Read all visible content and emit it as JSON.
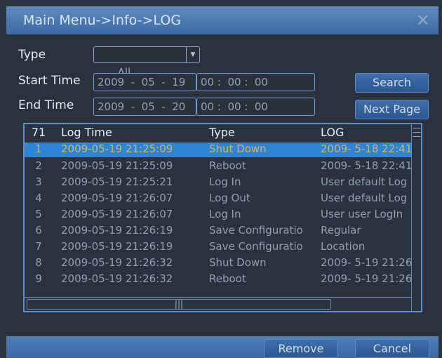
{
  "title": "Main Menu->Info->LOG",
  "close_icon": "✕",
  "filters": {
    "type_label": "Type",
    "type_value": "All",
    "start_label": "Start Time",
    "start_date": "2009  -  05  -  19",
    "start_time": "00 :  00 :  00",
    "end_label": "End Time",
    "end_date": "2009  -  05  -  20",
    "end_time": "00 :  00 :  00"
  },
  "buttons": {
    "search": "Search",
    "next_page": "Next Page",
    "remove": "Remove",
    "cancel": "Cancel"
  },
  "table": {
    "headers": [
      "71",
      "Log Time",
      "Type",
      "LOG"
    ],
    "rows": [
      [
        "1",
        "2009-05-19 21:25:09",
        "Shut Down",
        "2009- 5-18 22:41"
      ],
      [
        "2",
        "2009-05-19 21:25:09",
        "Reboot",
        "2009- 5-18 22:41"
      ],
      [
        "3",
        "2009-05-19 21:25:21",
        "Log In",
        "User default Log"
      ],
      [
        "4",
        "2009-05-19 21:26:07",
        "Log Out",
        "User default Log"
      ],
      [
        "5",
        "2009-05-19 21:26:07",
        "Log In",
        "User user LogIn"
      ],
      [
        "6",
        "2009-05-19 21:26:19",
        "Save Configuratio",
        "Regular"
      ],
      [
        "7",
        "2009-05-19 21:26:19",
        "Save Configuratio",
        "Location"
      ],
      [
        "8",
        "2009-05-19 21:26:32",
        "Shut Down",
        "2009- 5-19 21:26"
      ],
      [
        "9",
        "2009-05-19 21:26:32",
        "Reboot",
        "2009- 5-19 21:26"
      ]
    ],
    "selected_row": 0
  },
  "colors": {
    "title_bar": "#4a7ab5",
    "selected_row": "#2f84d4",
    "selected_text": "#d4b35a",
    "accent_border": "#5f8fcb"
  }
}
